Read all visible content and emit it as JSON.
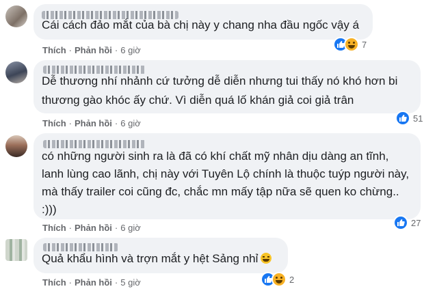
{
  "colors": {
    "bubble": "#f0f2f5",
    "like": "#1877f2",
    "haha": "#f7b125",
    "meta": "#65676b"
  },
  "actions": {
    "like_label": "Thích",
    "reply_label": "Phản hồi",
    "separator": "·"
  },
  "comments": [
    {
      "author": "Hương Nguyễn Hương Hoa",
      "text": [
        "Cái cách đảo mắt của bà chị này y chang nha đầu ngốc vậy á"
      ],
      "time": "6 giờ",
      "reactions": [
        "like-icon",
        "haha-icon"
      ],
      "count": "7"
    },
    {
      "author": "",
      "text": [
        "Dễ thương nhí nhảnh cứ tưởng dễ diễn nhưng tui thấy nó khó hơn bi",
        "thương gào khóc ấy chứ. Vì diễn quá lố khán giả coi giả trân"
      ],
      "time": "6 giờ",
      "reactions": [
        "like-icon"
      ],
      "count": "51"
    },
    {
      "author": "Trần Thị Ngọc Hân",
      "text": [
        "có những người sinh ra là đã có khí chất mỹ nhân dịu dàng an tĩnh,",
        "lanh lùng cao lãnh, chị này với Tuyên Lộ chính là thuộc tuýp người này,",
        "mà thấy trailer coi cũng đc, chắc mn mấy tập nữa sẽ quen ko chừng..",
        ":)))"
      ],
      "time": "6 giờ",
      "reactions": [
        "like-icon"
      ],
      "count": "27"
    },
    {
      "author": "",
      "text": [
        "Quả khẩu hình và trợn mắt y hệt Sảng nhỉ"
      ],
      "time": "5 giờ",
      "reactions": [
        "like-icon",
        "haha-icon"
      ],
      "count": "2"
    }
  ]
}
